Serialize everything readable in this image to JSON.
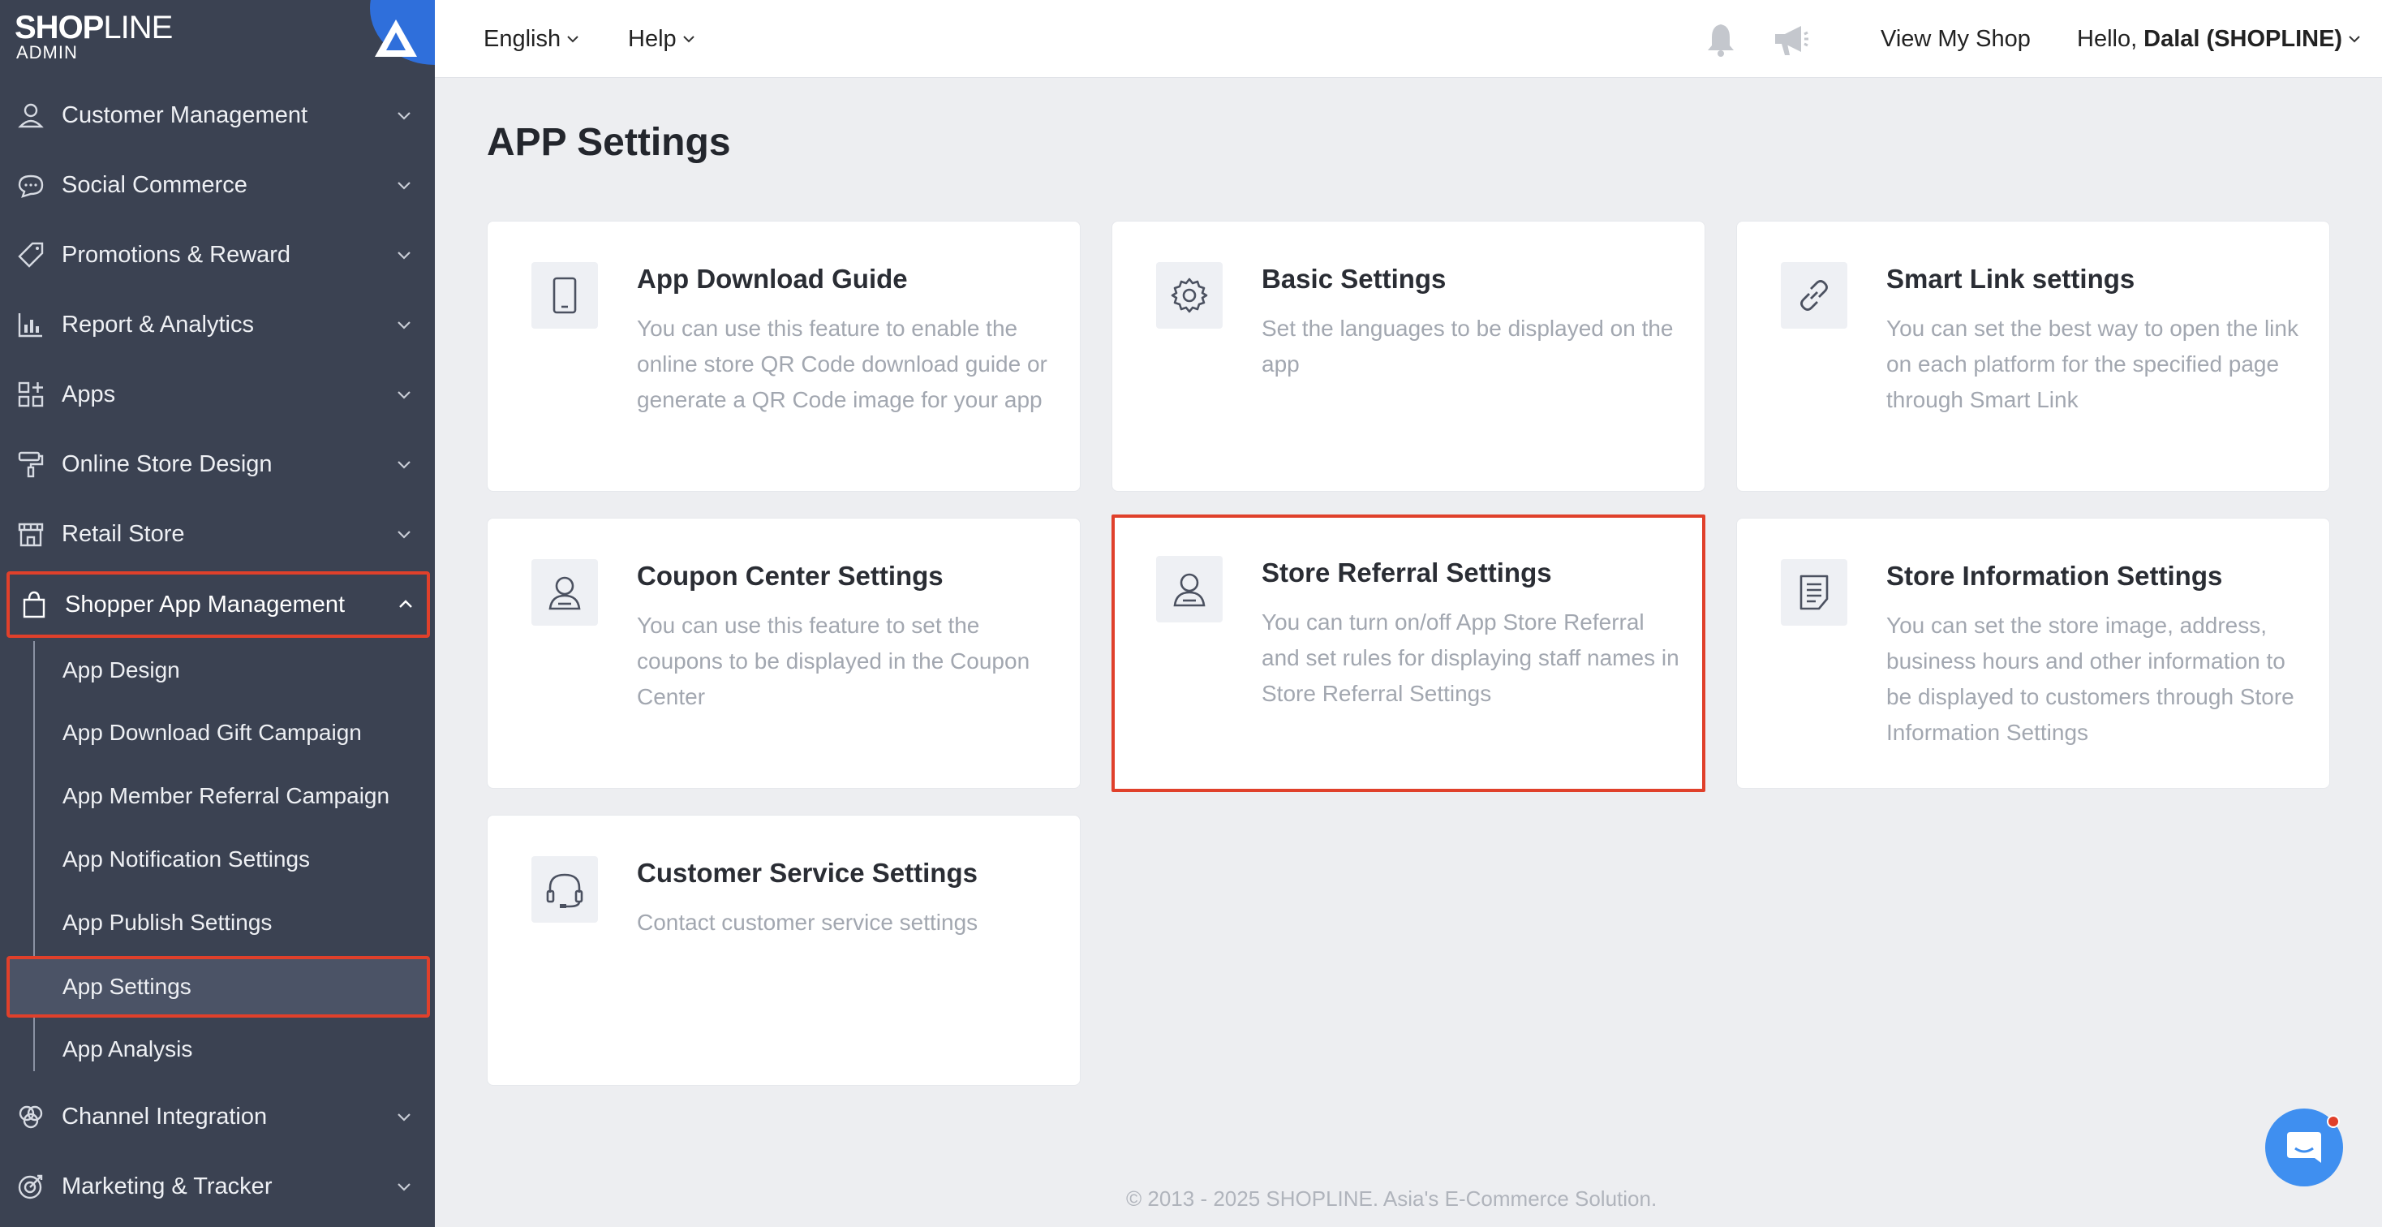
{
  "brand": {
    "logo_bold": "SHOP",
    "logo_light": "LINE",
    "logo_sub": "ADMIN"
  },
  "sidebar": {
    "items": [
      {
        "label": "Customer Management",
        "icon": "person-icon"
      },
      {
        "label": "Social Commerce",
        "icon": "chat-bubble-icon"
      },
      {
        "label": "Promotions & Reward",
        "icon": "tag-icon"
      },
      {
        "label": "Report & Analytics",
        "icon": "bar-chart-icon"
      },
      {
        "label": "Apps",
        "icon": "apps-grid-icon"
      },
      {
        "label": "Online Store Design",
        "icon": "paint-roller-icon"
      },
      {
        "label": "Retail Store",
        "icon": "storefront-icon"
      },
      {
        "label": "Shopper App Management",
        "icon": "shopping-bag-icon",
        "expanded": true
      },
      {
        "label": "Channel Integration",
        "icon": "channels-icon"
      },
      {
        "label": "Marketing & Tracker",
        "icon": "target-icon"
      }
    ],
    "subitems": [
      {
        "label": "App Design"
      },
      {
        "label": "App Download Gift Campaign"
      },
      {
        "label": "App Member Referral Campaign"
      },
      {
        "label": "App Notification Settings"
      },
      {
        "label": "App Publish Settings"
      },
      {
        "label": "App Settings",
        "active": true
      },
      {
        "label": "App Analysis"
      }
    ]
  },
  "topbar": {
    "language": "English",
    "help": "Help",
    "view_shop": "View My Shop",
    "hello": "Hello,",
    "user": "Dalal (SHOPLINE)"
  },
  "page": {
    "title": "APP Settings"
  },
  "cards": [
    {
      "title": "App Download Guide",
      "desc": "You can use this feature to enable the online store QR Code download guide or generate a QR Code image for your app",
      "icon": "mobile-phone-icon"
    },
    {
      "title": "Basic Settings",
      "desc": "Set the languages to be displayed on the app",
      "icon": "gear-icon"
    },
    {
      "title": "Smart Link settings",
      "desc": "You can set the best way to open the link on each platform for the specified page through Smart Link",
      "icon": "link-icon"
    },
    {
      "title": "Coupon Center Settings",
      "desc": "You can use this feature to set the coupons to be displayed in the Coupon Center",
      "icon": "user-icon"
    },
    {
      "title": "Store Referral Settings",
      "desc": "You can turn on/off App Store Referral and set rules for displaying staff names in Store Referral Settings",
      "icon": "user-icon"
    },
    {
      "title": "Store Information Settings",
      "desc": "You can set the store image, address, business hours and other information to be displayed to customers through Store Information Settings",
      "icon": "document-icon"
    },
    {
      "title": "Customer Service Settings",
      "desc": "Contact customer service settings",
      "icon": "headset-icon"
    }
  ],
  "footer": {
    "text": "© 2013 - 2025  SHOPLINE. Asia's E-Commerce Solution."
  },
  "colors": {
    "sidebar_bg": "#3b4252",
    "highlight": "#e0402b",
    "accent": "#3f8ff0"
  }
}
